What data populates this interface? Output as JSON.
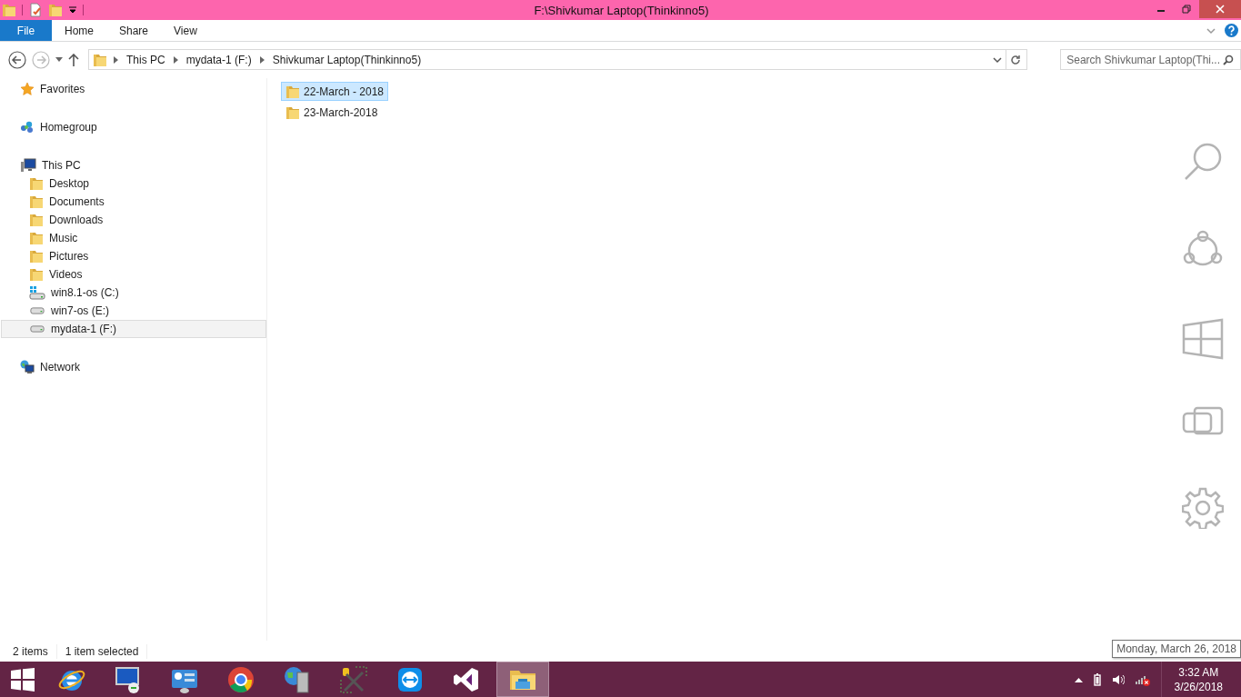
{
  "window": {
    "title": "F:\\Shivkumar Laptop(Thinkinno5)"
  },
  "ribbon": {
    "tabs": [
      {
        "label": "File",
        "kind": "file"
      },
      {
        "label": "Home",
        "kind": "tab"
      },
      {
        "label": "Share",
        "kind": "tab"
      },
      {
        "label": "View",
        "kind": "tab"
      }
    ]
  },
  "address_bar": {
    "crumbs": [
      "This PC",
      "mydata-1 (F:)",
      "Shivkumar Laptop(Thinkinno5)"
    ]
  },
  "search": {
    "placeholder": "Search Shivkumar Laptop(Thi..."
  },
  "nav_pane": {
    "items": [
      {
        "label": "Favorites",
        "kind": "star",
        "selected": false
      },
      {
        "label": "Homegroup",
        "kind": "homegroup",
        "selected": false
      },
      {
        "label": "This PC",
        "kind": "pc",
        "selected": false,
        "children": [
          {
            "label": "Desktop",
            "kind": "folder",
            "selected": false
          },
          {
            "label": "Documents",
            "kind": "folder",
            "selected": false
          },
          {
            "label": "Downloads",
            "kind": "folder",
            "selected": false
          },
          {
            "label": "Music",
            "kind": "folder",
            "selected": false
          },
          {
            "label": "Pictures",
            "kind": "folder",
            "selected": false
          },
          {
            "label": "Videos",
            "kind": "folder",
            "selected": false
          },
          {
            "label": "win8.1-os (C:)",
            "kind": "systemdrive",
            "selected": false
          },
          {
            "label": "win7-os (E:)",
            "kind": "drive",
            "selected": false
          },
          {
            "label": "mydata-1 (F:)",
            "kind": "drive",
            "selected": true
          }
        ]
      },
      {
        "label": "Network",
        "kind": "network",
        "selected": false
      }
    ]
  },
  "files": [
    {
      "name": "22-March - 2018",
      "selected": true
    },
    {
      "name": "23-March-2018",
      "selected": false
    }
  ],
  "status_bar": {
    "item_count": "2 items",
    "selection": "1 item selected"
  },
  "taskbar": {
    "apps": [
      {
        "kind": "browser",
        "selected": false
      },
      {
        "kind": "remote",
        "selected": false
      },
      {
        "kind": "panel",
        "selected": false
      },
      {
        "kind": "circle",
        "selected": false
      },
      {
        "kind": "server",
        "selected": false
      },
      {
        "kind": "tools",
        "selected": false
      },
      {
        "kind": "arrows",
        "selected": false
      },
      {
        "kind": "infinity",
        "selected": false
      },
      {
        "kind": "folder",
        "selected": true
      }
    ],
    "time": "3:32 AM",
    "date": "3/26/2018",
    "tooltip": "Monday, March 26, 2018"
  }
}
